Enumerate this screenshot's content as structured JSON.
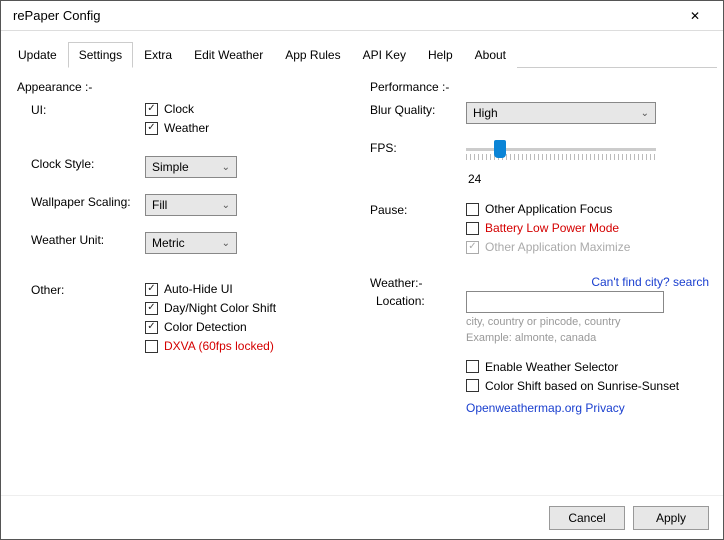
{
  "window": {
    "title": "rePaper Config"
  },
  "tabs": [
    "Update",
    "Settings",
    "Extra",
    "Edit Weather",
    "App Rules",
    "API Key",
    "Help",
    "About"
  ],
  "active_tab": 1,
  "left": {
    "section": "Appearance :-",
    "ui_label": "UI:",
    "ui_clock": "Clock",
    "ui_weather": "Weather",
    "clock_style_label": "Clock Style:",
    "clock_style_value": "Simple",
    "wallpaper_scaling_label": "Wallpaper Scaling:",
    "wallpaper_scaling_value": "Fill",
    "weather_unit_label": "Weather Unit:",
    "weather_unit_value": "Metric",
    "other_label": "Other:",
    "auto_hide": "Auto-Hide UI",
    "day_night": "Day/Night Color Shift",
    "color_detection": "Color Detection",
    "dxva": "DXVA (60fps locked)"
  },
  "right": {
    "section": "Performance :-",
    "blur_label": "Blur Quality:",
    "blur_value": "High",
    "fps_label": "FPS:",
    "fps_value": "24",
    "pause_label": "Pause:",
    "pause_focus": "Other Application Focus",
    "pause_battery": "Battery Low Power Mode",
    "pause_maximize": "Other Application Maximize",
    "weather_section": "Weather:-",
    "location_label": "Location:",
    "find_city_link": "Can't find city? search",
    "location_hint1": "city, country or pincode, country",
    "location_hint2": "Example: almonte, canada",
    "enable_selector": "Enable Weather Selector",
    "color_shift_sun": "Color Shift based on Sunrise-Sunset",
    "owm_link": "Openweathermap.org Privacy"
  },
  "footer": {
    "cancel": "Cancel",
    "apply": "Apply"
  }
}
